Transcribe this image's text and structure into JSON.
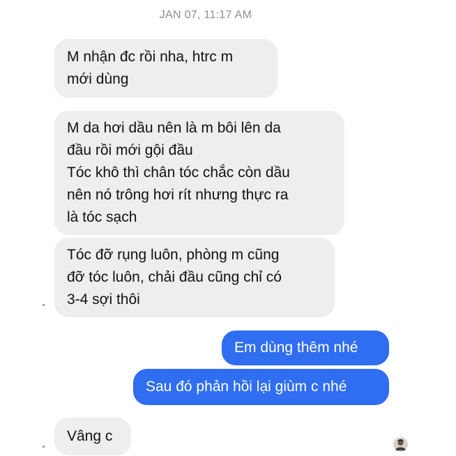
{
  "thread": {
    "timestamp": "JAN 07, 11:17 AM",
    "messages": [
      {
        "direction": "incoming",
        "text": "M nhận đc rồi nha, htrc m\nmới dùng"
      },
      {
        "direction": "incoming",
        "text": "M da hơi dầu nên là m bôi lên da\nđầu rồi mới gội đầu\nTóc khô thì chân tóc chắc còn dầu\nnên nó trông hơi rít nhưng thực ra\nlà tóc sạch"
      },
      {
        "direction": "incoming",
        "text": "Tóc đỡ rụng luôn, phòng m cũng\nđỡ tóc luôn, chải đầu cũng chỉ có\n3-4 sợi thôi"
      },
      {
        "direction": "outgoing",
        "text": "Em dùng thêm nhé"
      },
      {
        "direction": "outgoing",
        "text": "Sau đó phản hồi lại giùm c nhé"
      },
      {
        "direction": "incoming",
        "text": "Vâng c"
      }
    ],
    "avatar_icon": "profile-avatar-icon"
  },
  "colors": {
    "incoming_bubble": "#eeeeef",
    "outgoing_bubble": "#2f6df1",
    "timestamp_text": "#8e8e93"
  }
}
